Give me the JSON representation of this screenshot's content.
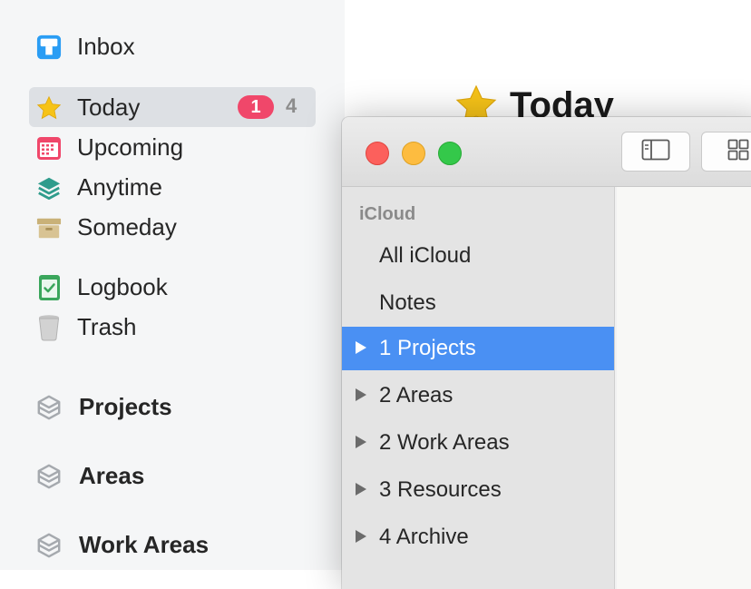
{
  "things": {
    "nav": {
      "inbox": "Inbox",
      "today": "Today",
      "today_badge": "1",
      "today_count": "4",
      "upcoming": "Upcoming",
      "anytime": "Anytime",
      "someday": "Someday",
      "logbook": "Logbook",
      "trash": "Trash"
    },
    "sections": [
      "Projects",
      "Areas",
      "Work Areas"
    ],
    "main_title": "Today",
    "colors": {
      "inbox": "#2a9df4",
      "today_star": "#f6c318",
      "upcoming": "#f0476a",
      "anytime": "#2f9c8c",
      "someday": "#c9b178",
      "logbook": "#3aa65c",
      "trash": "#a9a9a9",
      "badge": "#f0476a"
    }
  },
  "notes": {
    "group_header": "iCloud",
    "folders": [
      {
        "label": "All iCloud",
        "has_children": false,
        "selected": false
      },
      {
        "label": "Notes",
        "has_children": false,
        "selected": false
      },
      {
        "label": "1 Projects",
        "has_children": true,
        "selected": true
      },
      {
        "label": "2 Areas",
        "has_children": true,
        "selected": false
      },
      {
        "label": "2 Work Areas",
        "has_children": true,
        "selected": false
      },
      {
        "label": "3 Resources",
        "has_children": true,
        "selected": false
      },
      {
        "label": "4 Archive",
        "has_children": true,
        "selected": false
      }
    ],
    "colors": {
      "selection": "#4a90f3",
      "close": "#fc605c",
      "minimize": "#fdbc40",
      "maximize": "#34c84a"
    },
    "toolbar_icons": [
      "sidebar-toggle-icon",
      "gallery-view-icon"
    ]
  }
}
